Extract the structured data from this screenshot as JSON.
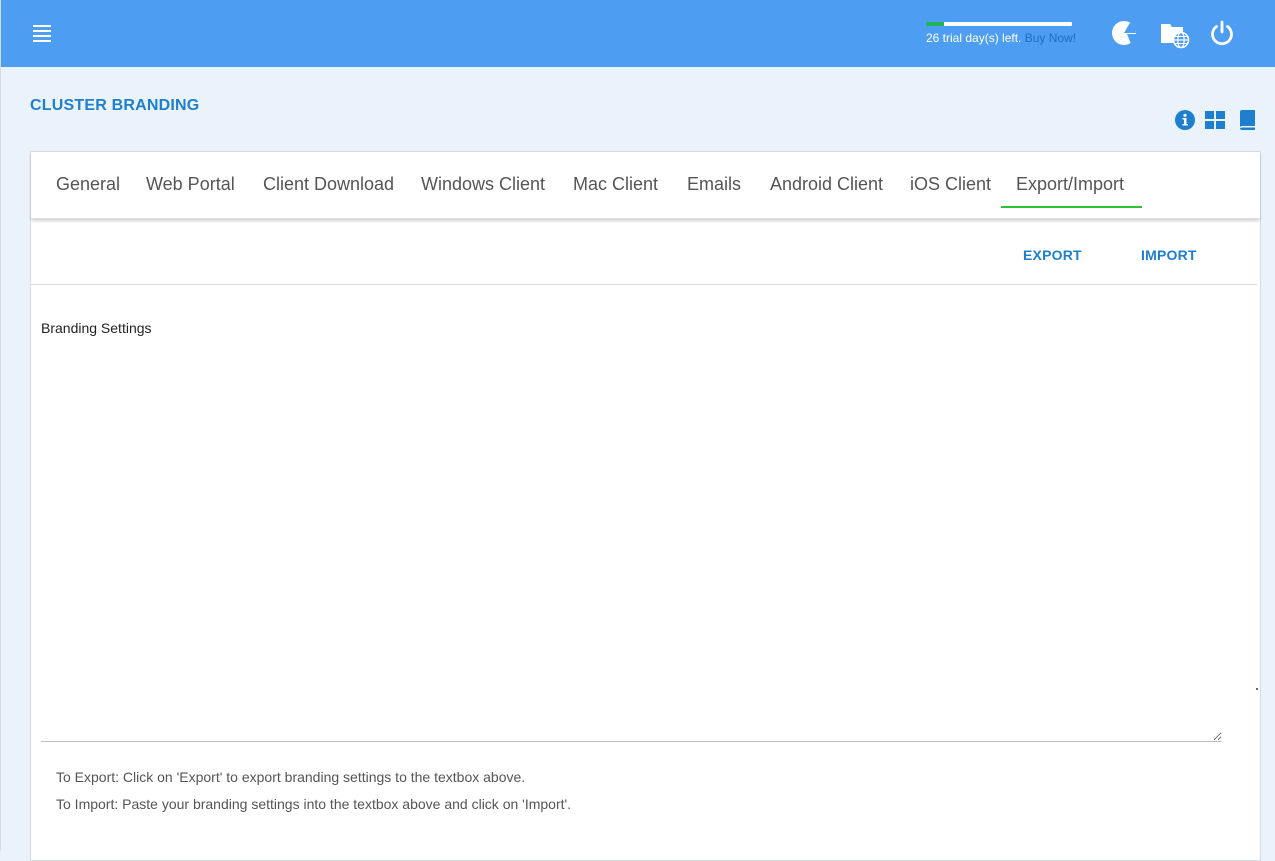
{
  "topbar": {
    "menu_icon": "hamburger-menu-icon",
    "trial": {
      "progress": 0.12,
      "text": "26 trial day(s) left.",
      "buy_label": "Buy Now!"
    },
    "icons": [
      "pie-chart-icon",
      "folder-globe-icon",
      "power-icon"
    ]
  },
  "page": {
    "title": "CLUSTER BRANDING",
    "header_icons": [
      "info-icon",
      "grid-icon",
      "book-icon"
    ]
  },
  "tabs": [
    {
      "label": "General"
    },
    {
      "label": "Web Portal"
    },
    {
      "label": "Client Download"
    },
    {
      "label": "Windows Client"
    },
    {
      "label": "Mac Client"
    },
    {
      "label": "Emails"
    },
    {
      "label": "Android Client"
    },
    {
      "label": "iOS Client"
    },
    {
      "label": "Export/Import",
      "active": true
    }
  ],
  "actions": {
    "export_label": "EXPORT",
    "import_label": "IMPORT"
  },
  "settings": {
    "label": "Branding Settings",
    "value": ""
  },
  "help": {
    "export_text": "To Export: Click on 'Export' to export branding settings to the textbox above.",
    "import_text": "To Import: Paste your branding settings into the textbox above and click on 'Import'."
  },
  "colors": {
    "topbar": "#4d9df2",
    "accent": "#1e7fcf",
    "active_tab": "#2ec234",
    "trial_fill": "#1fb35a"
  }
}
